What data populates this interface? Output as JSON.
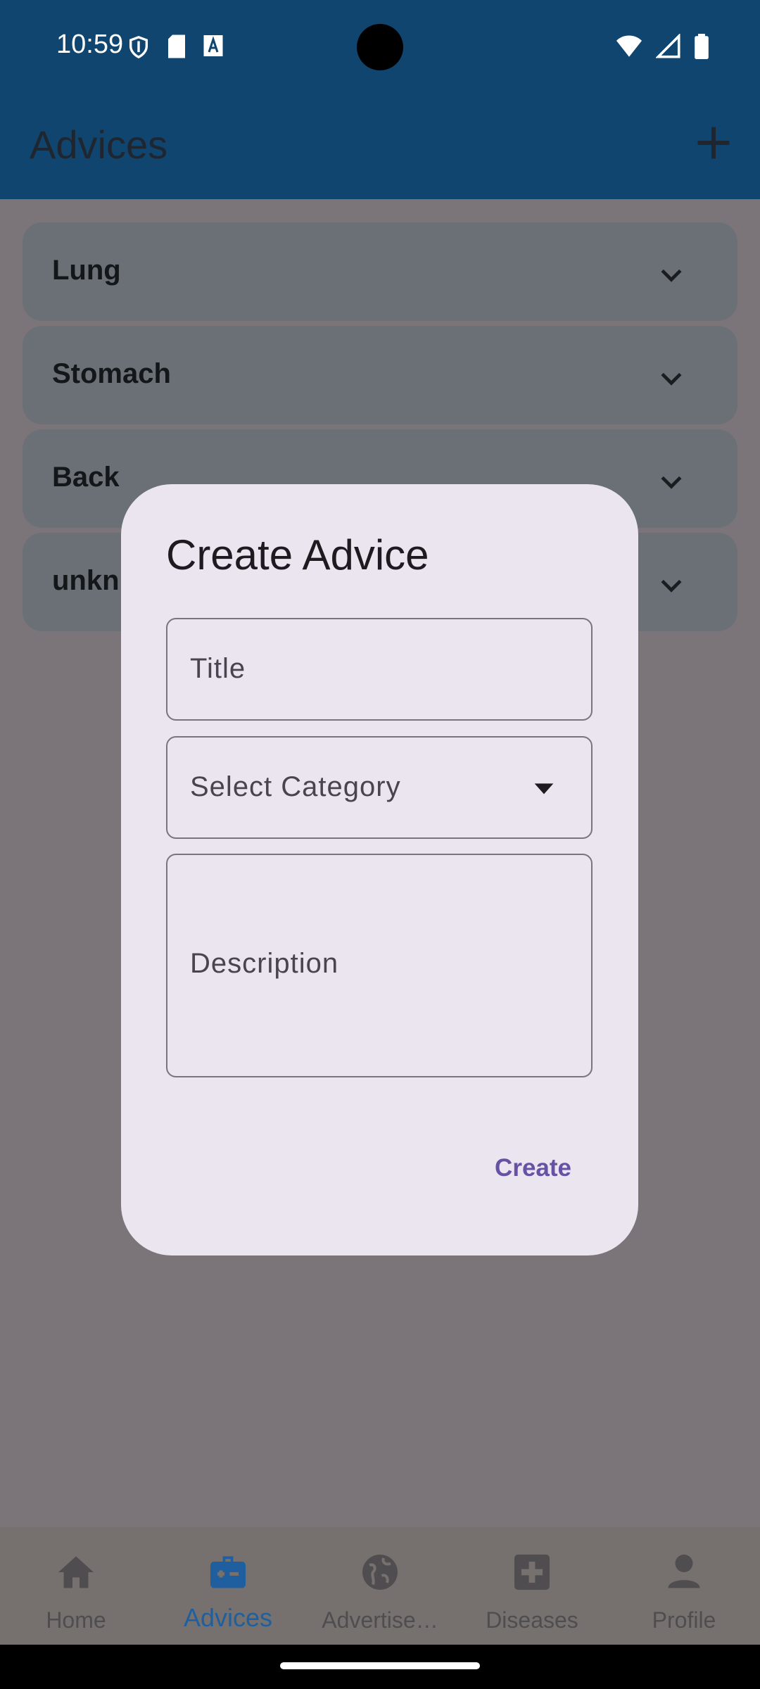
{
  "status_bar": {
    "time": "10:59",
    "left_icons": [
      "shield-icon",
      "sd-card-icon",
      "font-a-icon"
    ],
    "right_icons": [
      "wifi-icon",
      "signal-icon",
      "battery-icon"
    ]
  },
  "app_bar": {
    "title": "Advices",
    "add_icon": "plus-icon"
  },
  "categories": [
    {
      "label": "Lung"
    },
    {
      "label": "Stomach"
    },
    {
      "label": "Back"
    },
    {
      "label": "unkn"
    }
  ],
  "dialog": {
    "title": "Create Advice",
    "title_field_label": "Title",
    "category_field_label": "Select Category",
    "description_field_label": "Description",
    "create_label": "Create"
  },
  "bottom_nav": {
    "items": [
      {
        "label": "Home",
        "icon": "home-icon",
        "active": false
      },
      {
        "label": "Advices",
        "icon": "medical-bag-icon",
        "active": true
      },
      {
        "label": "Advertise…",
        "icon": "globe-icon",
        "active": false
      },
      {
        "label": "Diseases",
        "icon": "medical-cross-icon",
        "active": false
      },
      {
        "label": "Profile",
        "icon": "person-icon",
        "active": false
      }
    ]
  },
  "colors": {
    "primary": "#0f456e",
    "dialog_bg": "#ebe5ef",
    "accent_text": "#6751a4",
    "active_nav": "#1f5fa0"
  }
}
